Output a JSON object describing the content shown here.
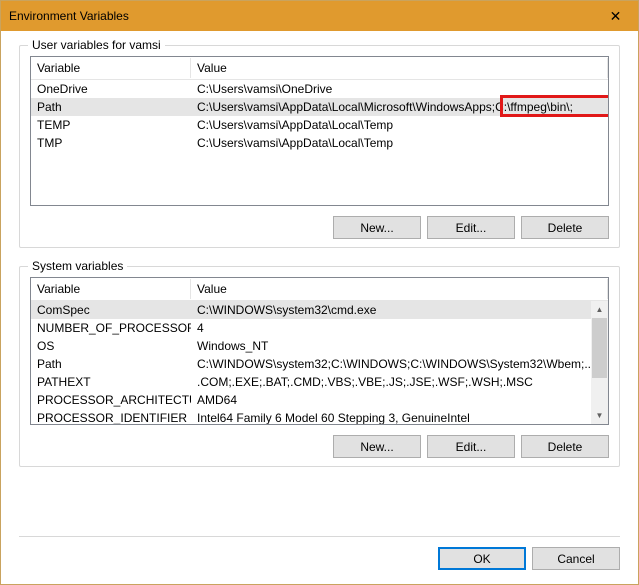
{
  "window": {
    "title": "Environment Variables"
  },
  "user_group": {
    "label": "User variables for vamsi",
    "header_variable": "Variable",
    "header_value": "Value",
    "rows": [
      {
        "variable": "OneDrive",
        "value": "C:\\Users\\vamsi\\OneDrive"
      },
      {
        "variable": "Path",
        "value": "C:\\Users\\vamsi\\AppData\\Local\\Microsoft\\WindowsApps;C:\\ffmpeg\\bin\\;"
      },
      {
        "variable": "TEMP",
        "value": "C:\\Users\\vamsi\\AppData\\Local\\Temp"
      },
      {
        "variable": "TMP",
        "value": "C:\\Users\\vamsi\\AppData\\Local\\Temp"
      }
    ],
    "selected_index": 1,
    "buttons": {
      "new": "New...",
      "edit": "Edit...",
      "delete": "Delete"
    }
  },
  "system_group": {
    "label": "System variables",
    "header_variable": "Variable",
    "header_value": "Value",
    "rows": [
      {
        "variable": "ComSpec",
        "value": "C:\\WINDOWS\\system32\\cmd.exe"
      },
      {
        "variable": "NUMBER_OF_PROCESSORS",
        "value": "4"
      },
      {
        "variable": "OS",
        "value": "Windows_NT"
      },
      {
        "variable": "Path",
        "value": "C:\\WINDOWS\\system32;C:\\WINDOWS;C:\\WINDOWS\\System32\\Wbem;..."
      },
      {
        "variable": "PATHEXT",
        "value": ".COM;.EXE;.BAT;.CMD;.VBS;.VBE;.JS;.JSE;.WSF;.WSH;.MSC"
      },
      {
        "variable": "PROCESSOR_ARCHITECTURE",
        "value": "AMD64"
      },
      {
        "variable": "PROCESSOR_IDENTIFIER",
        "value": "Intel64 Family 6 Model 60 Stepping 3, GenuineIntel"
      }
    ],
    "selected_index": 0,
    "buttons": {
      "new": "New...",
      "edit": "Edit...",
      "delete": "Delete"
    }
  },
  "footer": {
    "ok": "OK",
    "cancel": "Cancel"
  }
}
